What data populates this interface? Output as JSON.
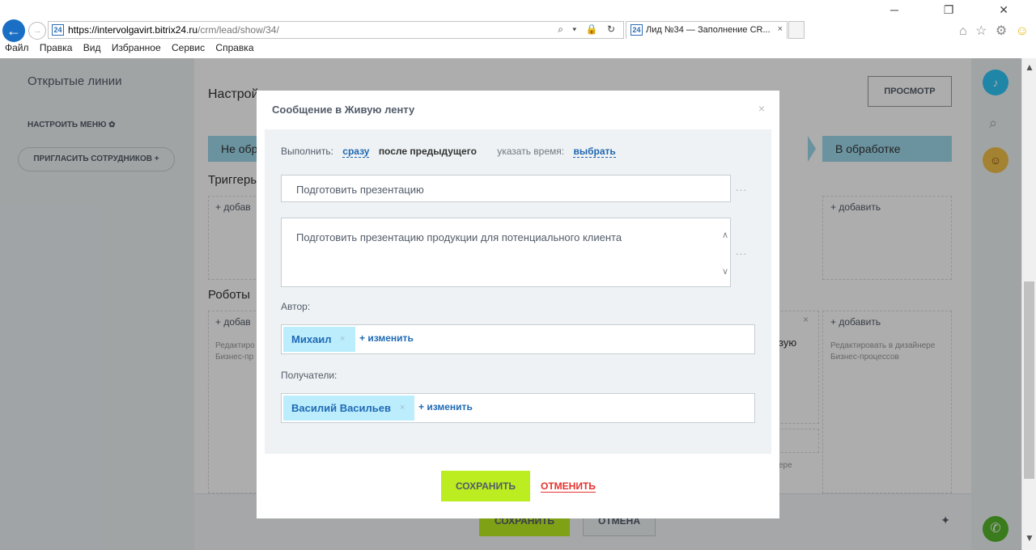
{
  "browser": {
    "url_host": "https://intervolgavirt.bitrix24.ru",
    "url_path": "/crm/lead/show/34/",
    "url_icons": "⌕ ▾ 🔒 ↻",
    "favicon": "24",
    "tab_title": "Лид №34 — Заполнение CR...",
    "tab_close": "×",
    "window_controls": "─ ❐ ✕",
    "tools": "⌂ ☆ ⚙",
    "smile": "☺",
    "menu": [
      "Файл",
      "Правка",
      "Вид",
      "Избранное",
      "Сервис",
      "Справка"
    ]
  },
  "sidebar": {
    "open_lines": "Открытые линии",
    "settings": "НАСТРОИТЬ МЕНЮ ✿",
    "invite": "ПРИГЛАСИТЬ СОТРУДНИКОВ +"
  },
  "background": {
    "title": "Настрой",
    "preview": "ПРОСМОТР",
    "stage_left": "Не обр",
    "stage_right": "В обработке",
    "triggers": "Триггеры",
    "robots": "Роботы",
    "add_short": "+ добав",
    "add_full": "+ добавить",
    "edit_short": "Редактиро Бизнес-пр",
    "edit_full": "Редактировать в дизайнере Бизнес-процессов",
    "frag_yu": "зую",
    "frag_re": "ере",
    "card_close": "×",
    "save": "СОХРАНИТЬ",
    "cancel": "ОТМЕНА"
  },
  "modal": {
    "title": "Сообщение в Живую ленту",
    "close": "×",
    "execute_label": "Выполнить:",
    "execute_now": "сразу",
    "execute_after": "после предыдущего",
    "time_label": "указать время:",
    "time_choose": "выбрать",
    "title_value": "Подготовить презентацию",
    "text_value": "Подготовить презентацию продукции для потенциального клиента",
    "dots": "...",
    "author_label": "Автор:",
    "author_tag": "Михаил",
    "tag_remove": "×",
    "change": "+ изменить",
    "recipients_label": "Получатели:",
    "recipient_tag": "Василий Васильев",
    "save": "СОХРАНИТЬ",
    "cancel": "ОТМЕНИТЬ"
  },
  "colors": {
    "accent_green": "#bbed21",
    "link_blue": "#2067b0",
    "cancel_red": "#e9312e",
    "tag_bg": "#bcedfc",
    "stage_bg": "#9dd8ea"
  }
}
